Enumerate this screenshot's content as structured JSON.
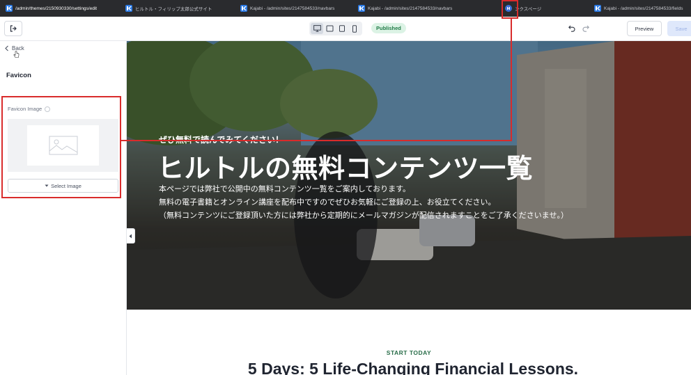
{
  "browser": {
    "tabs": [
      {
        "label": "/admin/themes/2150930330/settings/edit",
        "active": true
      },
      {
        "label": "ヒルトル・フィリップ太郎公式サイト",
        "active": false
      },
      {
        "label": "Kajabi - /admin/sites/2147584533/navbars",
        "active": false
      },
      {
        "label": "Kajabi - /admin/sites/2147584533/navbars",
        "active": false
      },
      {
        "label": "ンクスページ",
        "active": false
      },
      {
        "label": "Kajabi - /admin/sites/2147584533/fields",
        "active": false
      }
    ]
  },
  "toolbar": {
    "status": "Published",
    "preview_label": "Preview",
    "save_label": "Save"
  },
  "sidebar": {
    "back_label": "Back",
    "panel_title": "Favicon",
    "field_label": "Favicon Image",
    "select_button_label": "Select Image"
  },
  "hero": {
    "eyebrow": "ぜひ無料で読んでみてください！",
    "headline": "ヒルトルの無料コンテンツ一覧",
    "body": [
      "本ページでは弊社で公開中の無料コンテンツ一覧をご案内しております。",
      "無料の電子書籍とオンライン講座を配布中ですのでぜひお気軽にご登録の上、お役立てください。",
      "（無料コンテンツにご登録頂いた方には弊社から定期的にメールマガジンが配信されますことをご了承くださいませ。）"
    ]
  },
  "section": {
    "eyebrow": "START TODAY",
    "title": "5 Days: 5 Life-Changing Financial Lessons."
  },
  "colors": {
    "annotation": "#d92b2b",
    "published_bg": "#dcf3e5",
    "published_text": "#1f7a45",
    "accent_green": "#2a6e4a"
  }
}
